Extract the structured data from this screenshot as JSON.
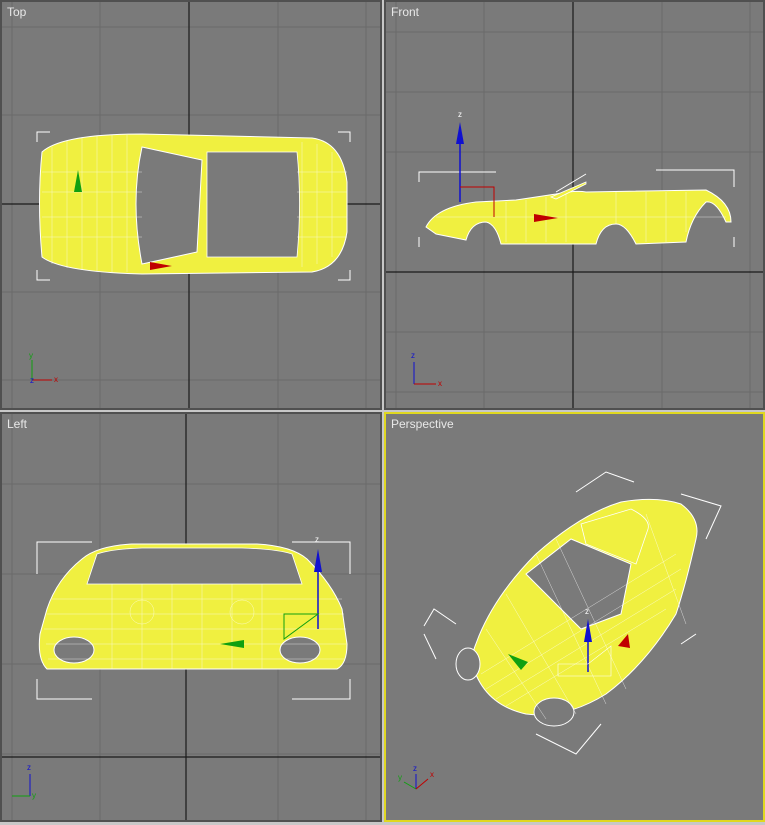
{
  "viewports": {
    "top": {
      "label": "Top"
    },
    "front": {
      "label": "Front"
    },
    "left": {
      "label": "Left"
    },
    "perspective": {
      "label": "Perspective"
    }
  },
  "axes": {
    "x": "x",
    "y": "y",
    "z": "z"
  },
  "colors": {
    "viewport_bg": "#7a7a7a",
    "grid": "#6a6a6a",
    "grid_main": "#1a1a1a",
    "model": "#f0f040",
    "active_border": "#e0d820",
    "gizmo_x": "#c00000",
    "gizmo_y": "#10a010",
    "gizmo_z": "#1010d0"
  },
  "active_viewport": "perspective"
}
